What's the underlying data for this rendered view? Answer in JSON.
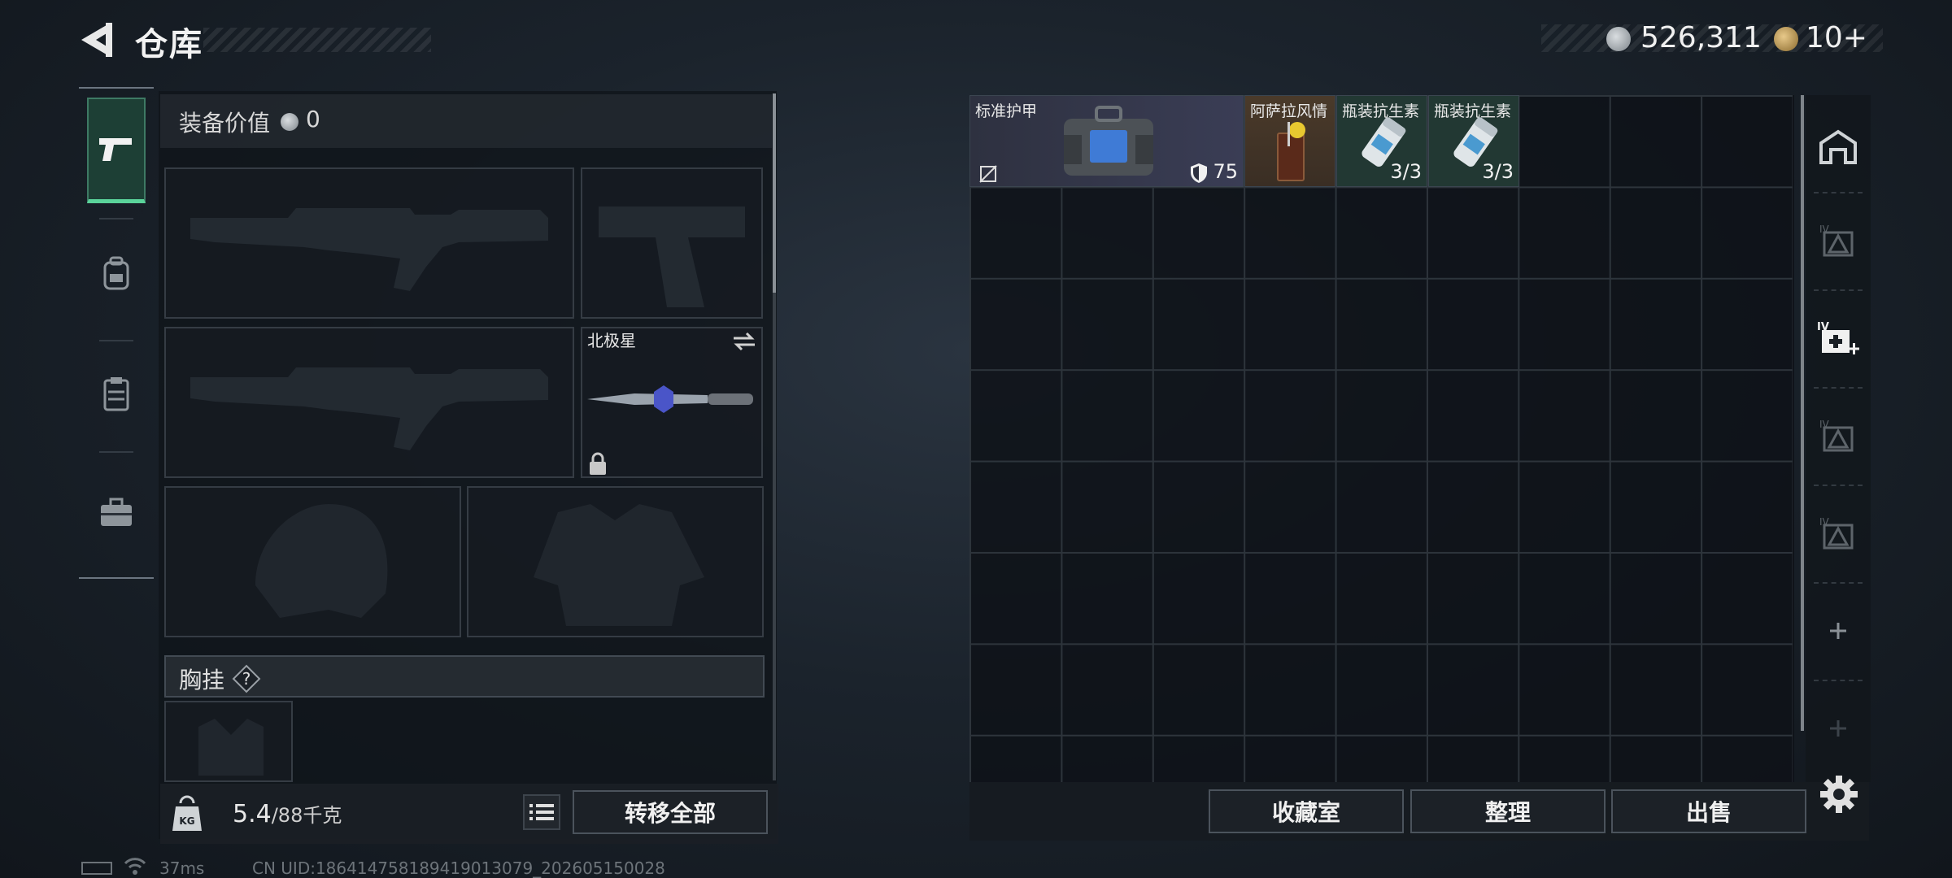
{
  "header": {
    "title": "仓库",
    "money": "526,311",
    "gold": "10+",
    "corner_hint": "≡≡≡ ≡ ≡≡"
  },
  "left_tabs": [
    {
      "name": "weapons",
      "icon": "pistol-icon",
      "active": true
    },
    {
      "name": "backpack",
      "icon": "backpack-icon",
      "active": false
    },
    {
      "name": "vest",
      "icon": "vest-icon",
      "active": false
    },
    {
      "name": "case",
      "icon": "briefcase-icon",
      "active": false
    }
  ],
  "equipment": {
    "value_label": "装备价值",
    "value": "0",
    "knife_name": "北极星",
    "chest_label": "胸挂",
    "chest_help": "?"
  },
  "weight": {
    "current": "5.4",
    "max_unit": "/88千克"
  },
  "buttons": {
    "transfer_all": "转移全部",
    "storage_room": "收藏室",
    "organize": "整理",
    "sell": "出售"
  },
  "items": [
    {
      "name": "标准护甲",
      "value": "75",
      "icon": "armor-bag-icon"
    },
    {
      "name": "阿萨拉风情",
      "icon": "drink-icon"
    },
    {
      "name": "瓶装抗生素",
      "count": "3/3",
      "icon": "pill-bottle-icon"
    },
    {
      "name": "瓶装抗生素",
      "count": "3/3",
      "icon": "pill-bottle-icon"
    }
  ],
  "footer": {
    "ping": "37ms",
    "uid": "CN UID:1864147581894190130​79_202605150028"
  },
  "colors": {
    "accent": "#5ad39a",
    "active_tab_bg": "#1d3f35",
    "armor_bg": "#3a3d55",
    "antibiotic_bg": "#223833"
  }
}
